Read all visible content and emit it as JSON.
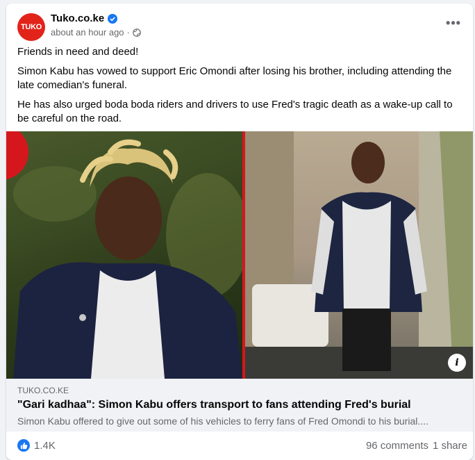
{
  "post": {
    "page_name": "Tuko.co.ke",
    "avatar_text": "TUKO",
    "time": "about an hour ago",
    "separator": "·",
    "more_label": "•••",
    "paragraphs": [
      "Friends in need and deed!",
      "Simon Kabu has vowed to support Eric Omondi after losing his brother, including attending the late comedian's funeral.",
      "He has also urged boda boda riders and drivers to use Fred's tragic death as a wake-up call to be careful on the road."
    ]
  },
  "link": {
    "domain": "TUKO.CO.KE",
    "headline": "\"Gari kadhaa\": Simon Kabu offers transport to fans attending Fred's burial",
    "description": "Simon Kabu offered to give out some of his vehicles to ferry fans of Fred Omondi to his burial...."
  },
  "image": {
    "info_label": "i"
  },
  "footer": {
    "likes": "1.4K",
    "comments": "96 comments",
    "shares": "1 share"
  },
  "colors": {
    "brand": "#e2231a",
    "link": "#1877f2",
    "secondary_text": "#65676b"
  }
}
